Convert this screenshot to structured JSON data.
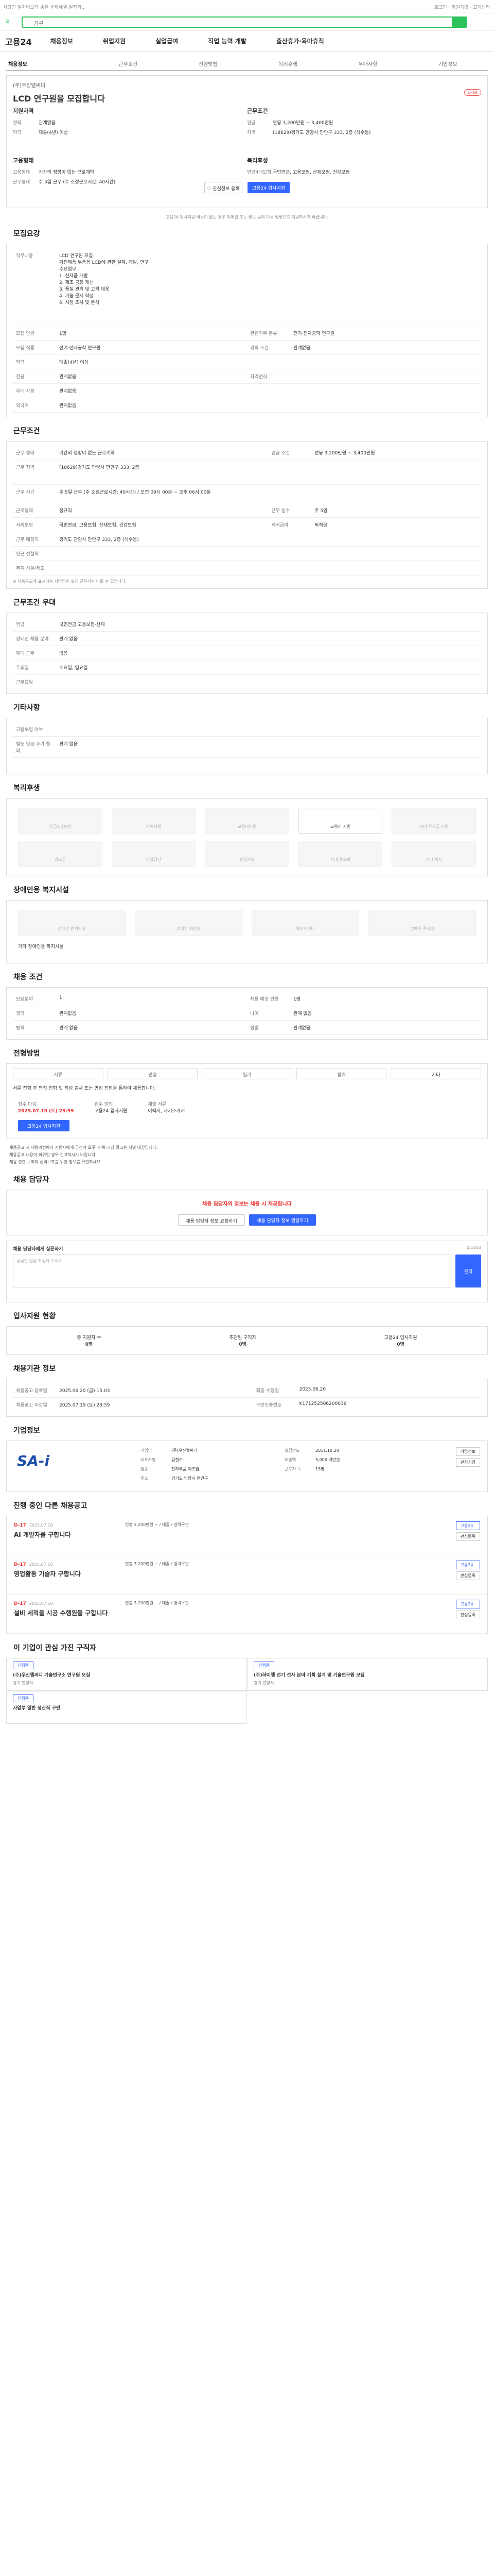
{
  "top": {
    "notice": "사람인 일자리보다 좋은 문제해결 일자리...",
    "links": "로그인 · 회원가입 · 고객센터"
  },
  "search": {
    "value": "가구"
  },
  "gnb": {
    "brand": "고용24",
    "menu": [
      "채용정보",
      "취업지원",
      "실업급여",
      "직업 능력 개발",
      "출산휴가·육아휴직"
    ],
    "edge": "TOP"
  },
  "tabs": [
    "채용정보",
    "근무조건",
    "전형방법",
    "복리후생",
    "우대사항",
    "기업정보"
  ],
  "job": {
    "company": "(주)우진엘씨디",
    "title": "LCD 연구원을 모집합니다",
    "badge": "D-99",
    "left_head": "지원자격",
    "left": [
      {
        "k": "경력",
        "v": "관계없음"
      },
      {
        "k": "학력",
        "v": "대졸(4년) 이상"
      }
    ],
    "right_head": "근무조건",
    "right": [
      {
        "k": "임금",
        "v": "연봉 3,200만원 ~ 3,400만원"
      },
      {
        "k": "지역",
        "v": "(18629)경기도 안양시 만안구 333, 2층 (석수동)"
      }
    ],
    "left2_head": "고용형태",
    "left2": [
      {
        "k": "고용형태",
        "v": "기간의 정함이 없는 근로계약"
      },
      {
        "k": "근무형태",
        "v": "주 5일 근무 (주 소정근로시간: 40시간)"
      }
    ],
    "right2_head": "복리후생",
    "right2": [
      {
        "k": "연금4대보험",
        "v": "국민연금, 고용보험, 산재보험, 건강보험"
      }
    ],
    "scrap": "관심정보 등록",
    "apply": "고용24 입사지원"
  },
  "notice": "고용24 입사지원 버튼이 없는 경우 이메일 또는 방문 등의 다른 방법으로 지원하시기 바랍니다.",
  "recruit": {
    "title": "모집요강",
    "desc_k": "직무내용",
    "desc": "LCD 연구원 모집\n가전제품 부품용 LCD에 관한 설계, 개발, 연구\n주요업무:\n1. 신제품 개발\n2. 제조 공정 개선\n3. 품질 관리 및 고객 대응\n4. 기술 문서 작성\n5. 시장 조사 및 분석",
    "rows": [
      {
        "k": "모집 인원",
        "v": "1명",
        "k2": "관련직무 분류",
        "v2": "전기·전자공학 연구원"
      },
      {
        "k": "모집 직종",
        "v": "전기·전자공학 연구원",
        "k2": "경력 조건",
        "v2": "관계없음"
      },
      {
        "k": "학력",
        "v": "대졸(4년) 이상"
      },
      {
        "k": "전공",
        "v": "관계없음",
        "k2": "자격면허",
        "v2": ""
      },
      {
        "k": "우대 사항",
        "v": "관계없음"
      },
      {
        "k": "외국어",
        "v": "관계없음"
      }
    ]
  },
  "conditions": {
    "title": "근무조건",
    "rows": [
      {
        "k": "근무 형태",
        "v": "기간의 정함이 없는 근로계약",
        "k2": "임금 조건",
        "v2": "연봉 3,200만원 ~ 3,400만원"
      },
      {
        "k": "근무 지역",
        "v": "(18629)경기도 안양시 만안구 333, 2층"
      },
      {
        "k": "근무 시간",
        "v": "주 5일 근무 (주 소정근로시간: 40시간) / 오전 09시 00분 ~ 오후 06시 00분"
      },
      {
        "k": "근로형태",
        "v": "정규직",
        "k2": "근무 일수",
        "v2": "주 5일"
      },
      {
        "k": "사회보험",
        "v": "국민연금, 고용보험, 산재보험, 건강보험",
        "k2": "퇴직급여",
        "v2": "퇴직금"
      },
      {
        "k": "근무 예정지",
        "v": "경기도 안양시 만안구 333, 2층 (석수동)"
      },
      {
        "k": "인근 전철역",
        "v": ""
      },
      {
        "k": "복지 시설/제도",
        "v": ""
      }
    ]
  },
  "map": {
    "title": "채용 정보 위치",
    "hint": "※ 채용공고에 표시되는 지역명은 실제 근무지와 다를 수 있습니다."
  },
  "apply": {
    "title": "근무조건 우대",
    "rows": [
      {
        "k": "연금",
        "v": "국민연금·고용보험·산재"
      },
      {
        "k": "장애인 채용 분야",
        "v": "관계 없음"
      },
      {
        "k": "재택 근무",
        "v": "없음"
      },
      {
        "k": "주휴일",
        "v": "토요일, 일요일"
      },
      {
        "k": "근무요일",
        "v": ""
      }
    ]
  },
  "extra": {
    "title": "기타사항",
    "rows": [
      {
        "k": "고용보험 여부",
        "v": ""
      },
      {
        "k": "별도 임금 추가 협의",
        "v": "관계 없음"
      }
    ]
  },
  "benefits": {
    "title": "복리후생",
    "tiles": [
      "연금4대보험",
      "식비지원",
      "교통비지원",
      "교육비 지원",
      "자녀 학자금 지원",
      "경조금",
      "건강검진",
      "휴양시설",
      "사내 동호회",
      "기타 복지"
    ]
  },
  "disabled": {
    "title": "장애인용 복지시설",
    "tiles": [
      "장애인 편의시설",
      "장애인 화장실",
      "엘리베이터",
      "장애인 주차장"
    ],
    "note": "기타 장애인용 복지시설"
  },
  "conditions2": {
    "title": "채용 조건",
    "rows": [
      {
        "k": "모집분야",
        "v": "1",
        "k2": "채용 예정 인원",
        "v2": "1명"
      },
      {
        "k": "경력",
        "v": "관계없음",
        "k2": "나이",
        "v2": "관계 없음"
      },
      {
        "k": "병역",
        "v": "관계 없음",
        "k2": "성별",
        "v2": "관계없음"
      }
    ]
  },
  "process": {
    "title": "전형방법",
    "steps": [
      "서류",
      "면접",
      "필기",
      "합격",
      "기타"
    ],
    "note": "서류 전형 후 면접 전형 및 적성 검사 또는 면접 전형을 통하여 채용합니다.",
    "deadline_k": "접수 마감",
    "deadline": "2025.07.19 (토) 23:59",
    "apply_k": "접수 방법",
    "apply_v": "고용24 입사지원",
    "docs_k": "제출 서류",
    "docs_v": "이력서, 자기소개서",
    "btn": "고용24 입사지원"
  },
  "warnings": [
    "채용공고 시 채용과정에서 지원자에게 금전적 요구, 허위·과장 광고는 처벌 대상입니다.",
    "채용공고 내용이 허위일 경우 신고하시기 바랍니다.",
    "채용 관련 구직자 권익보호를 위한 정보를 확인하세요."
  ],
  "consult": {
    "title": "채용 담당자",
    "msg": "채용 담당자의 정보는 채용 시 제공됩니다",
    "btn1": "채용 담당자 정보 요청하기",
    "btn2": "채용 담당자 정보 열람하기",
    "q_title": "채용 담당자에게 질문하기",
    "q_placeholder": "궁금한 점을 작성해 주세요.",
    "q_btn": "문의",
    "q_count": "0/1000"
  },
  "stats": {
    "title": "입사지원 현황",
    "items": [
      {
        "label": "총 지원자 수",
        "v": "0명"
      },
      {
        "label": "추천된 구직자",
        "v": "0명"
      },
      {
        "label": "고용24 입사지원",
        "v": "0명"
      }
    ]
  },
  "registration": {
    "title": "채용기관 정보",
    "rows": [
      {
        "k": "채용공고 등록일",
        "v": "2025.06.20 (금) 15:03",
        "k2": "최종 수정일",
        "v2": "2025.06.20"
      },
      {
        "k": "채용공고 마감일",
        "v": "2025.07.19 (토) 23:59",
        "k2": "구인인증번호",
        "v2": "K171252506200036"
      }
    ]
  },
  "company": {
    "title": "기업정보",
    "logo": "SA-i",
    "rows": [
      {
        "k": "기업명",
        "v": "(주)우진엘씨디"
      },
      {
        "k": "대표자명",
        "v": "김철수"
      },
      {
        "k": "업종",
        "v": "전자부품 제조업"
      },
      {
        "k": "주소",
        "v": "경기도 안양시 만안구"
      }
    ],
    "rows2": [
      {
        "k": "설립년도",
        "v": "2011.10.20"
      },
      {
        "k": "매출액",
        "v": "5,000 백만원"
      },
      {
        "k": "근로자 수",
        "v": "15명"
      }
    ],
    "btn1": "기업정보",
    "btn2": "관심기업"
  },
  "related": {
    "title": "진행 중인 다른 채용공고",
    "items": [
      {
        "d": "D-17",
        "date": "2025.07.10",
        "name": "AI 개발자를 구합니다",
        "info": "연봉 3,200만원 ~ / 대졸 / 경력무관"
      },
      {
        "d": "D-17",
        "date": "2025.07.10",
        "name": "영업활동 기술자 구합니다",
        "info": "연봉 3,200만원 ~ / 대졸 / 경력무관"
      },
      {
        "d": "D-17",
        "date": "2025.07.10",
        "name": "설비 세척을 시공 수행원을 구합니다",
        "info": "연봉 3,200만원 ~ / 대졸 / 경력무관"
      }
    ],
    "btn_a": "고용24",
    "btn_b": "관심등록"
  },
  "related_cmp": {
    "title": "이 기업이 관심 가진 구직자",
    "items": [
      {
        "tag": "진행중",
        "name": "(주)우진엘씨디 기술연구소 연구원 모집",
        "info": "경기 안양시"
      },
      {
        "tag": "진행중",
        "name": "(주)하이엘 전기 전자 분야 기획 설계 및 기술연구원 모집",
        "info": "경기 안양시"
      }
    ],
    "item3": {
      "tag": "진행중",
      "name": "사업부 일반 생산직 구인"
    }
  }
}
